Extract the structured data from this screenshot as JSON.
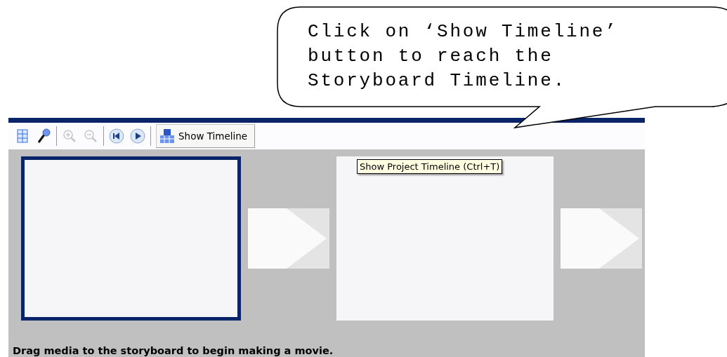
{
  "callout": {
    "lines": [
      "Click on ‘Show Timeline’",
      "button to reach the",
      "Storyboard Timeline."
    ]
  },
  "toolbar": {
    "groups": [
      [
        {
          "kind": "storyboard",
          "disabled": false
        },
        {
          "kind": "narrate",
          "disabled": false
        }
      ],
      [
        {
          "kind": "zoom-in",
          "disabled": true
        },
        {
          "kind": "zoom-out",
          "disabled": true
        }
      ],
      [
        {
          "kind": "rewind",
          "disabled": false
        },
        {
          "kind": "play",
          "disabled": false
        }
      ]
    ],
    "show_timeline": {
      "label": "Show Timeline"
    }
  },
  "tooltip": {
    "text": "Show Project Timeline (Ctrl+T)"
  },
  "storyboard": {
    "frames": [
      {
        "selected": true
      },
      {
        "selected": false
      }
    ],
    "hint": "Drag media to the storyboard to begin making a movie."
  }
}
